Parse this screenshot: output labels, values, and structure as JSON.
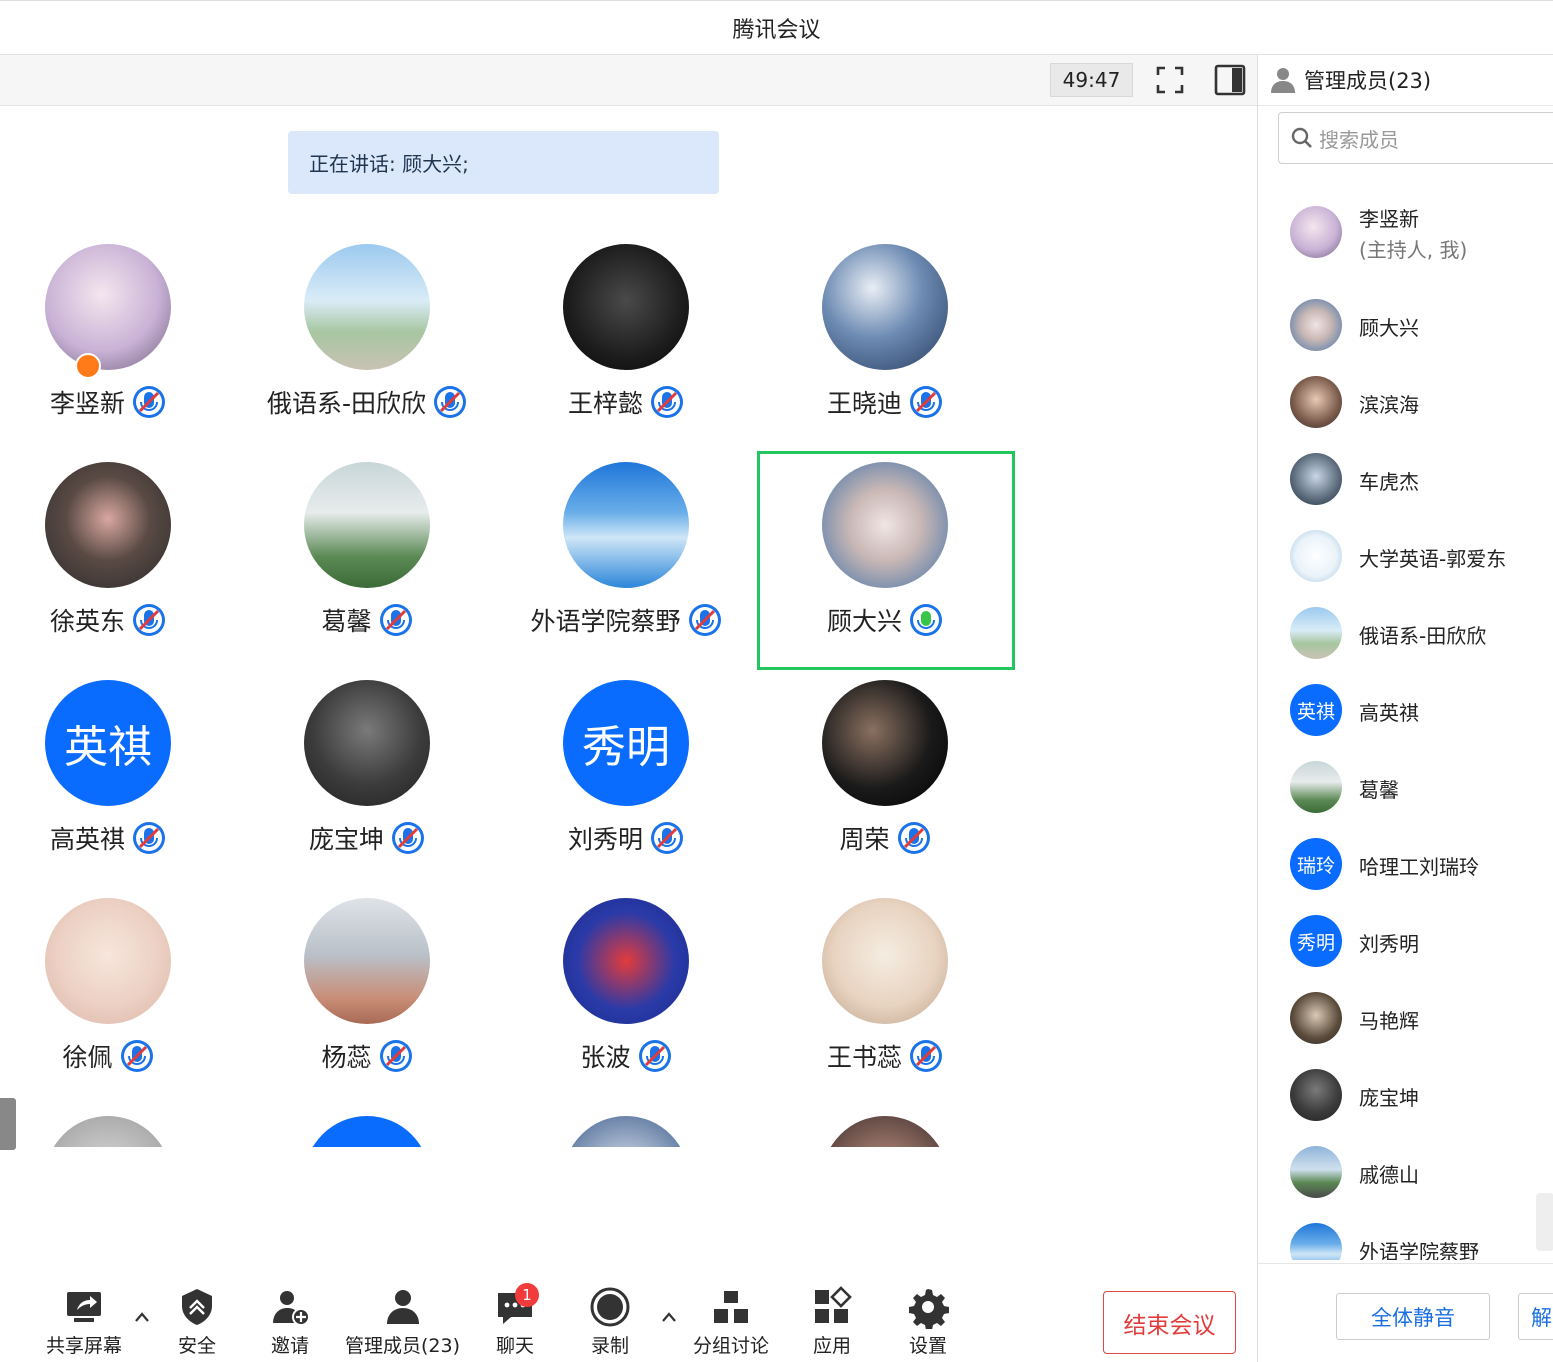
{
  "window": {
    "title": "腾讯会议"
  },
  "toolbar": {
    "timer": "49:47"
  },
  "speaking": {
    "text": "正在讲话: 顾大兴;"
  },
  "participants": [
    {
      "name": "李竖新",
      "avatar": "photo",
      "mic": "muted",
      "host": true
    },
    {
      "name": "俄语系-田欣欣",
      "avatar": "photo",
      "mic": "muted"
    },
    {
      "name": "王梓懿",
      "avatar": "photo",
      "mic": "muted"
    },
    {
      "name": "王晓迪",
      "avatar": "photo",
      "mic": "muted"
    },
    {
      "name": "徐英东",
      "avatar": "photo",
      "mic": "muted"
    },
    {
      "name": "葛馨",
      "avatar": "photo",
      "mic": "muted"
    },
    {
      "name": "外语学院蔡野",
      "avatar": "photo",
      "mic": "muted"
    },
    {
      "name": "顾大兴",
      "avatar": "photo",
      "mic": "speaking",
      "active_speaker": true
    },
    {
      "name": "高英祺",
      "avatar_text": "英祺",
      "mic": "muted"
    },
    {
      "name": "庞宝坤",
      "avatar": "photo",
      "mic": "muted"
    },
    {
      "name": "刘秀明",
      "avatar_text": "秀明",
      "mic": "muted"
    },
    {
      "name": "周荣",
      "avatar": "photo",
      "mic": "muted"
    },
    {
      "name": "徐佩",
      "avatar": "photo",
      "mic": "muted"
    },
    {
      "name": "杨蕊",
      "avatar": "photo",
      "mic": "muted"
    },
    {
      "name": "张波",
      "avatar": "photo",
      "mic": "muted"
    },
    {
      "name": "王书蕊",
      "avatar": "photo",
      "mic": "muted"
    }
  ],
  "bottom": {
    "share": "共享屏幕",
    "security": "安全",
    "invite": "邀请",
    "members": "管理成员(23)",
    "chat": "聊天",
    "chat_badge": "1",
    "record": "录制",
    "breakout": "分组讨论",
    "apps": "应用",
    "settings": "设置",
    "end": "结束会议"
  },
  "sidebar": {
    "title": "管理成员(23)",
    "search_placeholder": "搜索成员",
    "members": [
      {
        "name": "李竖新",
        "sub": "(主持人, 我)"
      },
      {
        "name": "顾大兴"
      },
      {
        "name": "滨滨海"
      },
      {
        "name": "车虎杰"
      },
      {
        "name": "大学英语-郭爱东"
      },
      {
        "name": "俄语系-田欣欣"
      },
      {
        "name": "高英祺",
        "avatar_text": "英祺"
      },
      {
        "name": "葛馨"
      },
      {
        "name": "哈理工刘瑞玲",
        "avatar_text": "瑞玲"
      },
      {
        "name": "刘秀明",
        "avatar_text": "秀明"
      },
      {
        "name": "马艳辉"
      },
      {
        "name": "庞宝坤"
      },
      {
        "name": "戚德山"
      },
      {
        "name": "外语学院蔡野"
      }
    ],
    "mute_all": "全体静音",
    "unmute_all": "解"
  },
  "colors": {
    "accent": "#0a6cff",
    "speaking_green": "#22c55e",
    "end_red": "#e03c3c",
    "banner": "#dbe8fb"
  }
}
